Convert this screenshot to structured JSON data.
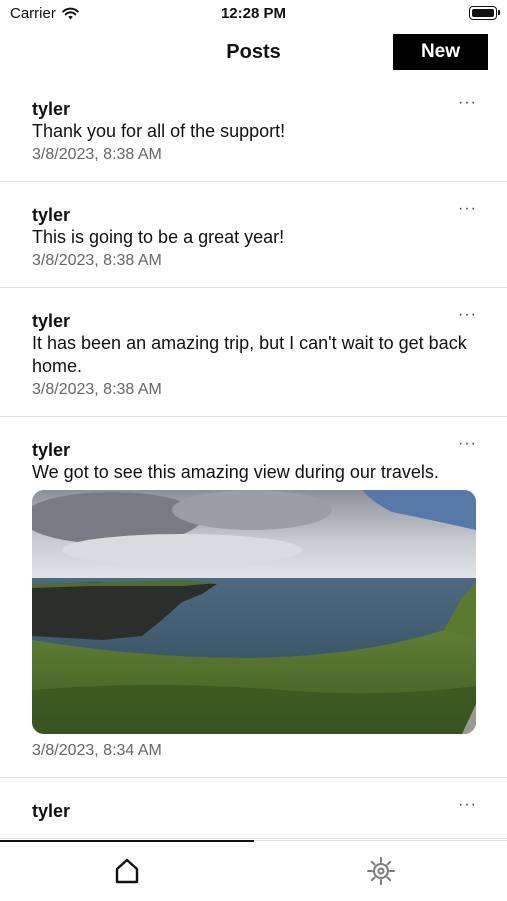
{
  "status_bar": {
    "carrier": "Carrier",
    "time": "12:28 PM"
  },
  "nav": {
    "title": "Posts",
    "new_label": "New"
  },
  "posts": [
    {
      "author": "tyler",
      "text": "Thank you for all of the support!",
      "date": "3/8/2023, 8:38 AM",
      "more": "···"
    },
    {
      "author": "tyler",
      "text": "This is going to be a great year!",
      "date": "3/8/2023, 8:38 AM",
      "more": "···"
    },
    {
      "author": "tyler",
      "text": "It has been an amazing trip, but I can't wait to get back home.",
      "date": "3/8/2023, 8:38 AM",
      "more": "···"
    },
    {
      "author": "tyler",
      "text": "We got to see this amazing view during our travels.",
      "date": "3/8/2023, 8:34 AM",
      "more": "···",
      "has_image": true
    },
    {
      "author": "tyler",
      "more": "···"
    }
  ],
  "tabs": [
    {
      "icon": "home-icon",
      "selected": true
    },
    {
      "icon": "gear-icon",
      "selected": false
    }
  ]
}
